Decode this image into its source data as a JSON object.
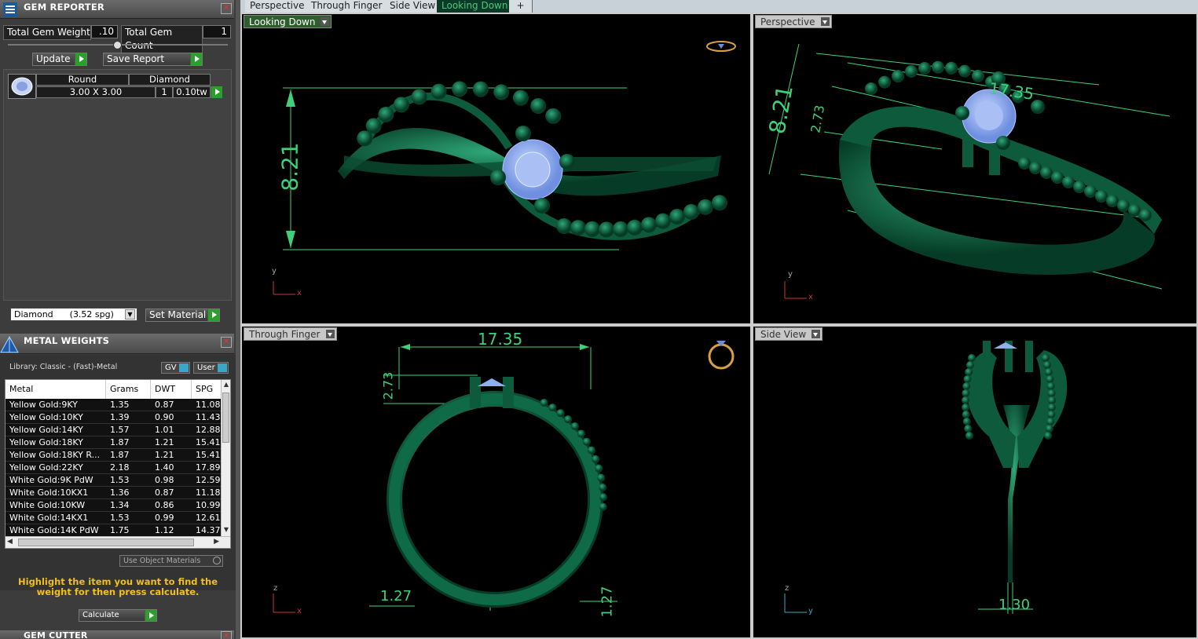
{
  "gem_reporter": {
    "title": "GEM REPORTER",
    "total_weight_label": "Total Gem Weight",
    "total_weight": ".10",
    "total_count_label": "Total Gem Count",
    "total_count": "1",
    "update": "Update",
    "save_report": "Save Report",
    "shape": "Round",
    "stone": "Diamond",
    "size": "3.00 X 3.00",
    "qty": "1",
    "tw": "0.10tw",
    "material_select": "Diamond      (3.52 spg)",
    "set_material": "Set Material"
  },
  "metal_weights": {
    "title": "METAL WEIGHTS",
    "library": "Library: Classic - (Fast)-Metal",
    "gv": "GV",
    "user": "User",
    "columns": [
      "Metal",
      "Grams",
      "DWT",
      "SPG"
    ],
    "rows": [
      [
        "Yellow Gold:9KY",
        "1.35",
        "0.87",
        "11.08"
      ],
      [
        "Yellow Gold:10KY",
        "1.39",
        "0.90",
        "11.43"
      ],
      [
        "Yellow Gold:14KY",
        "1.57",
        "1.01",
        "12.88"
      ],
      [
        "Yellow Gold:18KY",
        "1.87",
        "1.21",
        "15.41"
      ],
      [
        "Yellow Gold:18KY R...",
        "1.87",
        "1.21",
        "15.41"
      ],
      [
        "Yellow Gold:22KY",
        "2.18",
        "1.40",
        "17.89"
      ],
      [
        "White Gold:9K PdW",
        "1.53",
        "0.98",
        "12.59"
      ],
      [
        "White Gold:10KX1",
        "1.36",
        "0.87",
        "11.18"
      ],
      [
        "White Gold:10KW",
        "1.34",
        "0.86",
        "10.99"
      ],
      [
        "White Gold:14KX1",
        "1.53",
        "0.99",
        "12.61"
      ],
      [
        "White Gold:14K PdW",
        "1.75",
        "1.12",
        "14.37"
      ]
    ],
    "use_object": "Use Object Materials",
    "hint": "Highlight the item you want to find the weight for then press calculate.",
    "calculate": "Calculate"
  },
  "gem_cutter": {
    "title": "GEM CUTTER"
  },
  "tabs": [
    "Perspective",
    "Through Finger",
    "Side View",
    "Looking Down",
    "+"
  ],
  "viewports": {
    "looking_down": "Looking Down",
    "perspective": "Perspective",
    "through_finger": "Through Finger",
    "side_view": "Side View"
  },
  "dims": {
    "ld_height": "8.21",
    "p_height": "8.21",
    "p_small": "2.73",
    "p_len": "17.35",
    "tf_width": "17.35",
    "tf_small": "2.73",
    "tf_band_l": "1.27",
    "tf_band_r": "1.27",
    "sv_band": "1.30"
  },
  "axes": {
    "y": "y",
    "x": "x",
    "z": "z"
  },
  "colors": {
    "metal": "#0f6b47",
    "dim": "#3fd17a",
    "gem": "#8fb0f0",
    "hint": "#f0c020"
  }
}
